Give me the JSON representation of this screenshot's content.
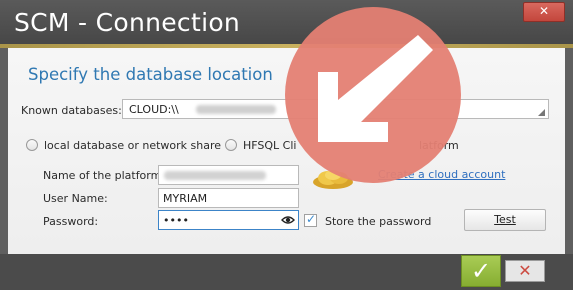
{
  "window": {
    "title": "SCM - Connection",
    "close_icon": "close-icon"
  },
  "main": {
    "heading": "Specify the database location",
    "known_databases_label": "Known databases:",
    "known_databases_value": "CLOUD:\\\\",
    "radio_local_label": "local database or network share",
    "radio_hfsql_label": "HFSQL Cli",
    "radio_platform_label": "latform",
    "platform_name_label": "Name of the platform:",
    "username_label": "User Name:",
    "username_value": "MYRIAM",
    "password_label": "Password:",
    "password_value": "••••",
    "create_cloud_link": "Create a cloud account",
    "store_password_label": "Store the password",
    "test_button_label": "Test"
  },
  "footer": {
    "ok_icon": "checkmark-icon",
    "cancel_icon": "x-icon"
  },
  "colors": {
    "title_bar": "#4d4d4d",
    "accent_gold": "#b8a14f",
    "heading_blue": "#2f78b2",
    "link_blue": "#2f6fbf",
    "ok_green": "#8fb83b",
    "cancel_red": "#cc4b41",
    "overlay_arrow": "#e47f73"
  }
}
